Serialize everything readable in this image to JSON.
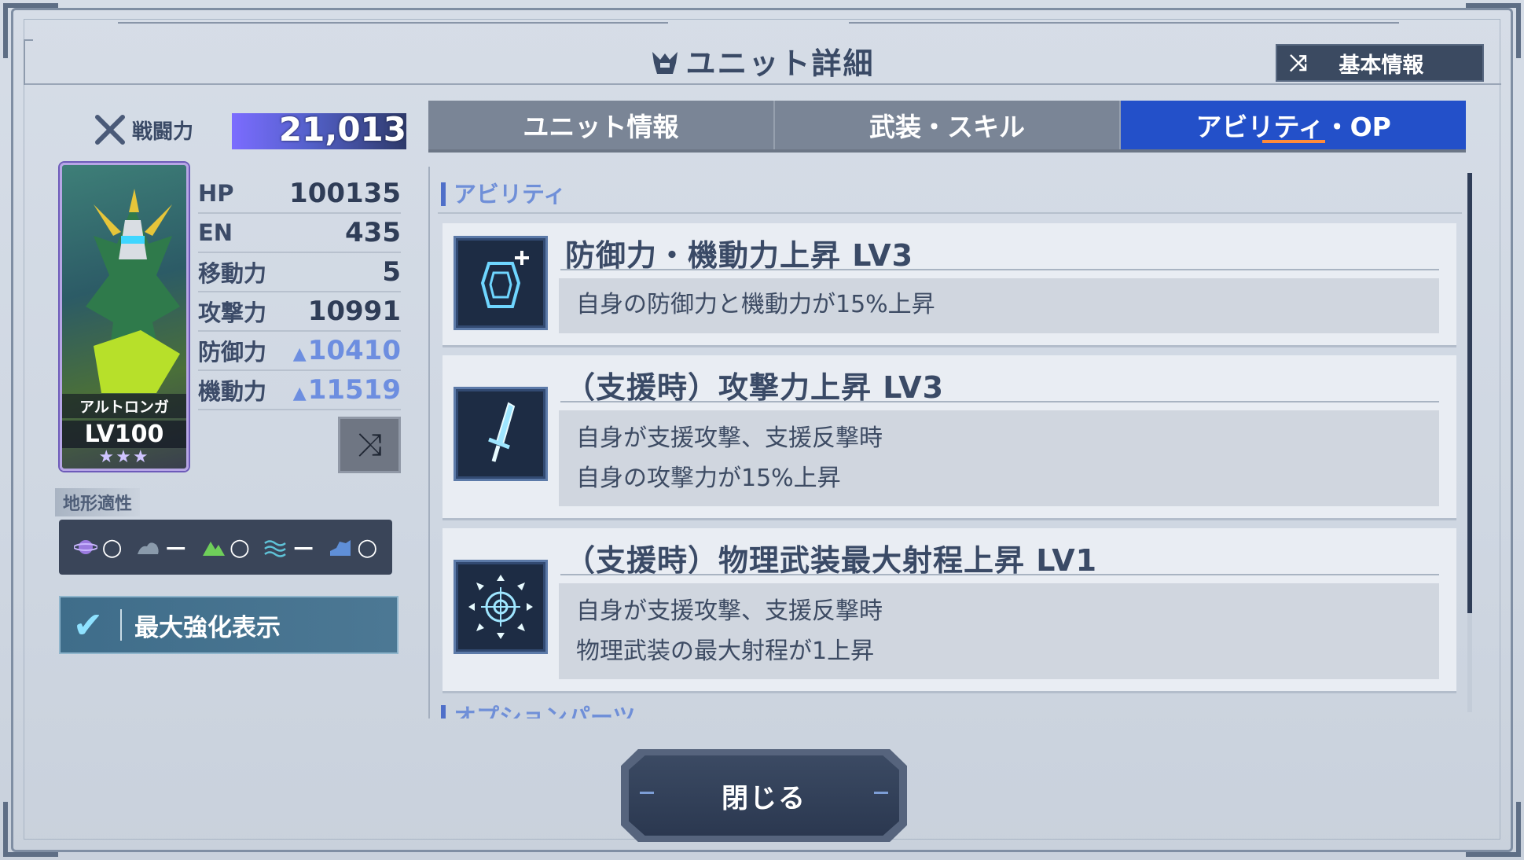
{
  "header": {
    "title": "ユニット詳細",
    "info_button_label": "基本情報"
  },
  "unit": {
    "power_label": "戦闘力",
    "power_value": "21,013",
    "name": "アルトロンガ",
    "level": "LV100",
    "stars": "★★★",
    "stats": [
      {
        "label": "HP",
        "value": "100135",
        "boosted": false
      },
      {
        "label": "EN",
        "value": "435",
        "boosted": false
      },
      {
        "label": "移動力",
        "value": "5",
        "boosted": false
      },
      {
        "label": "攻撃力",
        "value": "10991",
        "boosted": false
      },
      {
        "label": "防御力",
        "value": "10410",
        "boosted": true
      },
      {
        "label": "機動力",
        "value": "11519",
        "boosted": true
      }
    ],
    "terrain_label": "地形適性",
    "terrain": [
      {
        "icon": "space-icon",
        "rating": "○"
      },
      {
        "icon": "atmosphere-icon",
        "rating": "－"
      },
      {
        "icon": "ground-icon",
        "rating": "○"
      },
      {
        "icon": "water-icon",
        "rating": "－"
      },
      {
        "icon": "underwater-icon",
        "rating": "○"
      }
    ],
    "max_enhance_label": "最大強化表示"
  },
  "tabs": [
    {
      "label": "ユニット情報",
      "active": false
    },
    {
      "label": "武装・スキル",
      "active": false
    },
    {
      "label": "アビリティ・OP",
      "active": true
    }
  ],
  "abilities_section": "アビリティ",
  "abilities": [
    {
      "icon": "shield-plus-icon",
      "name": "防御力・機動力上昇 LV3",
      "lines": [
        "自身の防御力と機動力が15%上昇"
      ]
    },
    {
      "icon": "sword-icon",
      "name": "（支援時）攻撃力上昇 LV3",
      "lines": [
        "自身が支援攻撃、支援反撃時",
        "自身の攻撃力が15%上昇"
      ]
    },
    {
      "icon": "target-icon",
      "name": "（支援時）物理武装最大射程上昇 LV1",
      "lines": [
        "自身が支援攻撃、支援反撃時",
        "物理武装の最大射程が1上昇"
      ]
    }
  ],
  "options_section": "オプションパーツ",
  "close_label": "閉じる"
}
